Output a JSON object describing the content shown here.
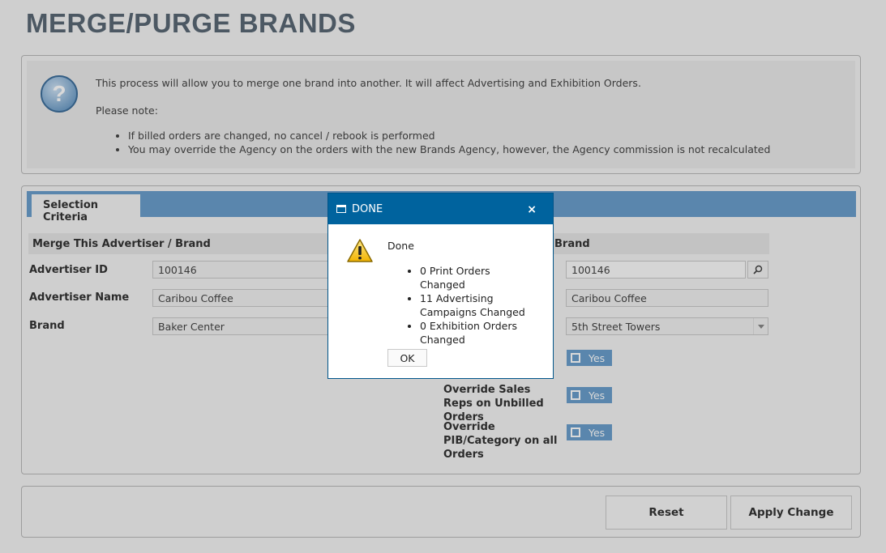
{
  "page": {
    "title": "MERGE/PURGE BRANDS"
  },
  "info": {
    "line1": "This process will allow you to merge one brand into another. It will affect Advertising and Exhibition Orders.",
    "line2": "Please note:",
    "bullets": [
      "If billed orders are changed, no cancel / rebook is performed",
      "You may override the Agency on the orders with the new Brands Agency, however, the Agency commission is not recalculated"
    ]
  },
  "tabs": {
    "selection_criteria": "Selection Criteria"
  },
  "merge_from": {
    "heading": "Merge This Advertiser / Brand",
    "advertiser_id_label": "Advertiser ID",
    "advertiser_id": "100146",
    "advertiser_name_label": "Advertiser Name",
    "advertiser_name": "Caribou Coffee",
    "brand_label": "Brand",
    "brand": "Baker Center"
  },
  "merge_into": {
    "heading": "Brand",
    "advertiser_id": "100146",
    "advertiser_name": "Caribou Coffee",
    "brand": "5th Street Towers",
    "toggle1_value": "Yes",
    "override_sales_reps_label": "Override Sales Reps on Unbilled Orders",
    "override_sales_reps_value": "Yes",
    "override_pib_label": "Override PIB/Category on all Orders",
    "override_pib_value": "Yes"
  },
  "actions": {
    "reset": "Reset",
    "apply": "Apply Change"
  },
  "dialog": {
    "title": "DONE",
    "close": "×",
    "message": "Done",
    "items": [
      "0 Print Orders Changed",
      "11 Advertising Campaigns Changed",
      "0 Exhibition Orders Changed"
    ],
    "ok": "OK"
  },
  "colors": {
    "accent": "#6a9ecc",
    "dialog_title": "#00639e"
  }
}
